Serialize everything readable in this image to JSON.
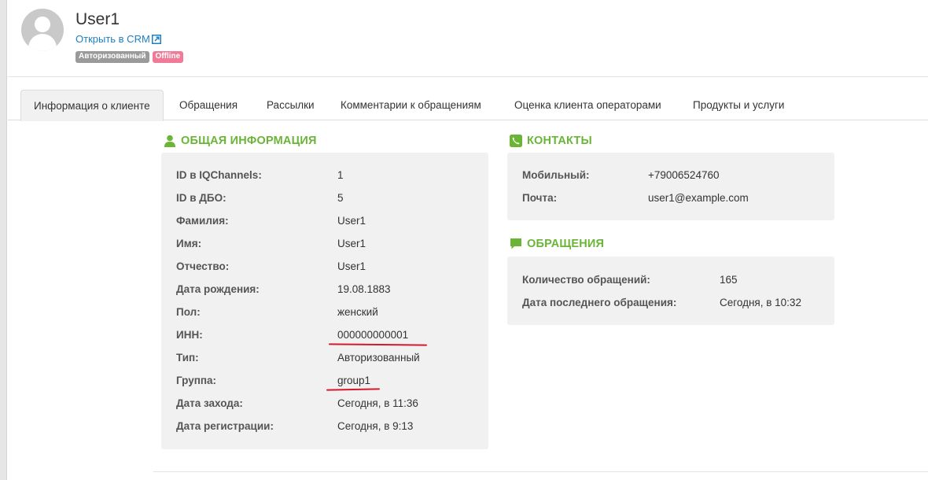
{
  "user": {
    "name": "User1",
    "crm_link": "Открыть в CRM",
    "badges": [
      "Авторизованный",
      "Offline"
    ]
  },
  "tabs": [
    {
      "label": "Информация о клиенте",
      "active": true
    },
    {
      "label": "Обращения"
    },
    {
      "label": "Рассылки"
    },
    {
      "label": "Комментарии к обращениям"
    },
    {
      "label": "Оценка клиента операторами"
    },
    {
      "label": "Продукты и услуги"
    }
  ],
  "general": {
    "title": "ОБЩАЯ ИНФОРМАЦИЯ",
    "rows": [
      {
        "label": "ID в IQChannels:",
        "value": "1"
      },
      {
        "label": "ID в ДБО:",
        "value": "5"
      },
      {
        "label": "Фамилия:",
        "value": "User1"
      },
      {
        "label": "Имя:",
        "value": "User1"
      },
      {
        "label": "Отчество:",
        "value": "User1"
      },
      {
        "label": "Дата рождения:",
        "value": "19.08.1883"
      },
      {
        "label": "Пол:",
        "value": "женский"
      },
      {
        "label": "ИНН:",
        "value": "000000000001"
      },
      {
        "label": "Тип:",
        "value": "Авторизованный"
      },
      {
        "label": "Группа:",
        "value": "group1"
      },
      {
        "label": "Дата захода:",
        "value": "Сегодня, в 11:36"
      },
      {
        "label": "Дата регистрации:",
        "value": "Сегодня, в 9:13"
      }
    ]
  },
  "contacts": {
    "title": "КОНТАКТЫ",
    "rows": [
      {
        "label": "Мобильный:",
        "value": "+79006524760"
      },
      {
        "label": "Почта:",
        "value": "user1@example.com"
      }
    ]
  },
  "appeals": {
    "title": "ОБРАЩЕНИЯ",
    "rows": [
      {
        "label": "Количество обращений:",
        "value": "165"
      },
      {
        "label": "Дата последнего обращения:",
        "value": "Сегодня, в 10:32"
      }
    ]
  },
  "colors": {
    "accent_green": "#6ab536",
    "link_blue": "#1e7fc1",
    "offline_pink": "#ef7b98",
    "annotation_red": "#d4192b"
  }
}
